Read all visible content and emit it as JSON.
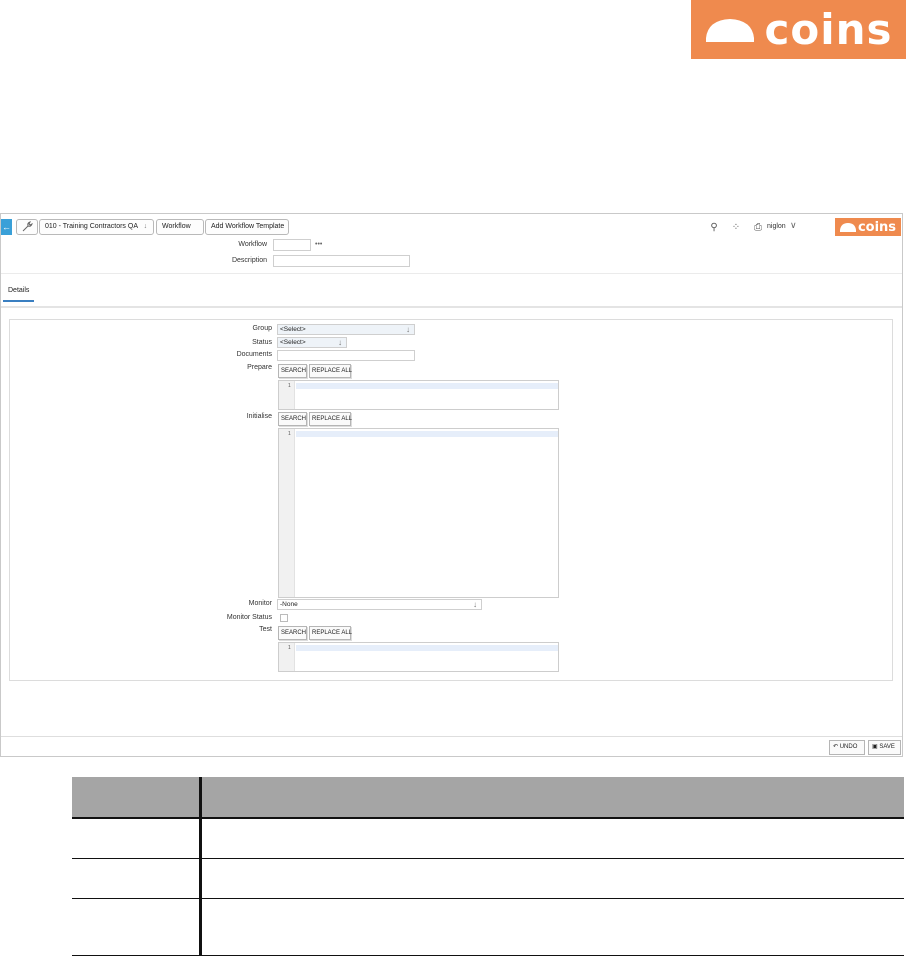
{
  "brand": {
    "logo_text": "coins",
    "accent": "#ef8a4e"
  },
  "nav": {
    "back_glyph": "←",
    "tool_icon": "wrench-icon",
    "company": "010 - Training Contractors QA",
    "company_chevron": "↓",
    "workflow": "Workflow",
    "template": "Add Workflow Template"
  },
  "header": {
    "search_icon": "⚲",
    "grid_icon": "⁘",
    "print_icon": "⎙",
    "user": "niglon",
    "user_chevron": "∨",
    "logo_text": "coins"
  },
  "form_top": {
    "workflow_label": "Workflow",
    "workflow_value": "",
    "dots": "•••",
    "description_label": "Description",
    "description_value": ""
  },
  "tabs": {
    "details": "Details"
  },
  "details": {
    "group_label": "Group",
    "group_value": "<Select>",
    "status_label": "Status",
    "status_value": "<Select>",
    "documents_label": "Documents",
    "prepare_label": "Prepare",
    "initialise_label": "Initialise",
    "monitor_label": "Monitor",
    "monitor_value": "-None",
    "monitor_status_label": "Monitor Status",
    "test_label": "Test",
    "search_btn": "SEARCH",
    "replace_btn": "REPLACE ALL",
    "line_no": "1"
  },
  "footer": {
    "undo": "UNDO",
    "save": "SAVE"
  },
  "doc_table": {
    "header": [
      "",
      ""
    ],
    "rows": [
      [
        "",
        ""
      ],
      [
        "",
        ""
      ],
      [
        "",
        ""
      ]
    ]
  }
}
